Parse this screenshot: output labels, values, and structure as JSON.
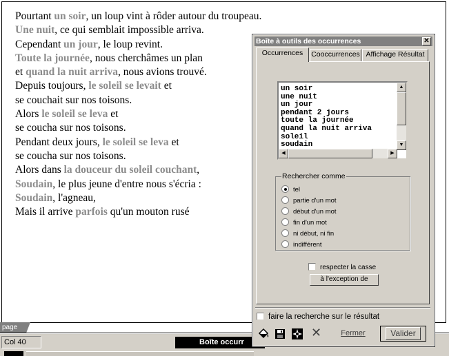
{
  "document": {
    "lines": [
      [
        {
          "t": "Pourtant "
        },
        {
          "t": "un soir",
          "hl": true
        },
        {
          "t": ", un loup vint à rôder autour du troupeau."
        }
      ],
      [
        {
          "t": "Une nuit",
          "hl": true
        },
        {
          "t": ", ce qui semblait impossible arriva."
        }
      ],
      [
        {
          "t": "Cependant "
        },
        {
          "t": "un jour",
          "hl": true
        },
        {
          "t": ", le loup revint."
        }
      ],
      [
        {
          "t": "Toute la journée",
          "hl": true
        },
        {
          "t": ", nous cherchâmes un plan"
        }
      ],
      [
        {
          "t": "et "
        },
        {
          "t": "quand la nuit arriva",
          "hl": true
        },
        {
          "t": ", nous avions trouvé."
        }
      ],
      [
        {
          "t": "Depuis toujours, "
        },
        {
          "t": "le soleil se levait",
          "hl": true
        },
        {
          "t": " et"
        }
      ],
      [
        {
          "t": "se couchait sur nos toisons."
        }
      ],
      [
        {
          "t": "Alors "
        },
        {
          "t": "le soleil se leva",
          "hl": true
        },
        {
          "t": " et"
        }
      ],
      [
        {
          "t": "se coucha sur nos toisons."
        }
      ],
      [
        {
          "t": "Pendant deux jours, "
        },
        {
          "t": "le soleil se leva",
          "hl": true
        },
        {
          "t": " et"
        }
      ],
      [
        {
          "t": "se coucha sur nos toisons."
        }
      ],
      [
        {
          "t": "Alors dans "
        },
        {
          "t": "la douceur du soleil couchant",
          "hl": true
        },
        {
          "t": ","
        }
      ],
      [
        {
          "t": "Soudain",
          "hl": true
        },
        {
          "t": ", le plus jeune d'entre nous s'écria :"
        }
      ],
      [
        {
          "t": "Soudain",
          "hl": true
        },
        {
          "t": ", l'agneau,"
        }
      ],
      [
        {
          "t": "Mais il arrive "
        },
        {
          "t": "parfois",
          "hl": true
        },
        {
          "t": " qu'un mouton rusé"
        }
      ]
    ]
  },
  "status": {
    "page_tab": "page",
    "col": "Col 40",
    "taskbar_item": "Boîte occurr"
  },
  "window": {
    "title": "Boîte à outils des occurrences",
    "close": "✕",
    "tabs": {
      "occurrences": "Occurrences",
      "cooccurrences": "Cooccurrences",
      "result": "Affichage Résultat"
    },
    "list_items": [
      "un soir",
      "une nuit",
      "un jour",
      "pendant 2 jours",
      "toute la journée",
      "quand la nuit arriva",
      "soleil",
      "soudain"
    ],
    "search_group": {
      "legend": "Rechercher comme",
      "options": [
        {
          "label": "tel",
          "selected": true
        },
        {
          "label": "partie d'un mot",
          "selected": false
        },
        {
          "label": "début d'un mot",
          "selected": false
        },
        {
          "label": "fin d'un mot",
          "selected": false
        },
        {
          "label": "ni début, ni fin",
          "selected": false
        },
        {
          "label": "indifférent",
          "selected": false
        }
      ]
    },
    "case_label": "respecter la casse",
    "except_button": "à l'exception de",
    "search_result_label": "faire la recherche sur le résultat",
    "fermer": "Fermer",
    "valider": "Valider"
  },
  "colors": {
    "highlight": "#8c8c8c",
    "window_bg": "#d4d0c8",
    "titlebar": "#808080"
  }
}
